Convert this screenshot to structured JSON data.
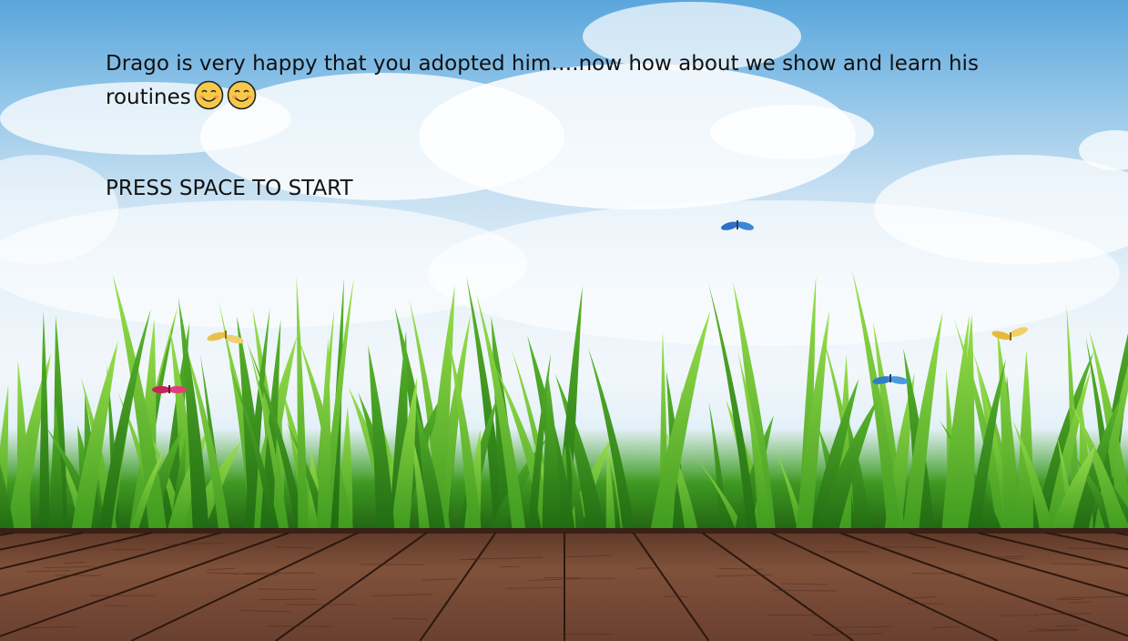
{
  "story": {
    "text": "Drago is very happy that you adopted him….now how about we show and learn his routines",
    "emoji": [
      "smiling-face-icon",
      "smiling-face-icon"
    ]
  },
  "prompt": {
    "text": "PRESS SPACE TO START"
  },
  "colors": {
    "sky_top": "#5aa6dc",
    "cloud": "#ffffff",
    "grass_dark": "#2f8f1a",
    "grass_light": "#7bd43a",
    "deck": "#7a4b35",
    "deck_dark": "#3a2118",
    "butterfly_yellow": "#e8c04a",
    "butterfly_blue": "#2f6fc8",
    "butterfly_red": "#c8245a"
  }
}
